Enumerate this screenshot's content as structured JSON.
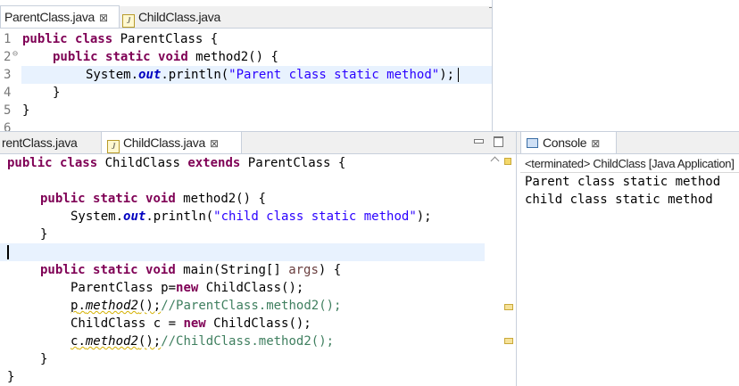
{
  "top_editor": {
    "tabs": [
      {
        "label": "ParentClass.java",
        "close": "⊠"
      },
      {
        "label": "ChildClass.java"
      }
    ],
    "line_numbers": [
      "1",
      "2",
      "3",
      "4",
      "5",
      "6"
    ],
    "fold_marker": "⊖",
    "lines": {
      "l1": {
        "kw1": "public",
        "kw2": "class",
        "rest": " ParentClass {"
      },
      "l2": {
        "kw1": "public",
        "kw2": "static",
        "kw3": "void",
        "rest": " method2() {"
      },
      "l3": {
        "pre": "System.",
        "field": "out",
        "mid": ".println(",
        "str": "\"Parent class static method\"",
        "end": ");"
      },
      "l4": {
        "text": "}"
      },
      "l5": {
        "text": "}"
      }
    }
  },
  "bottom_editor": {
    "tabs": [
      {
        "label": "rentClass.java"
      },
      {
        "label": "ChildClass.java",
        "close": "⊠"
      }
    ],
    "lines": {
      "l1": {
        "kw1": "public",
        "kw2": "class",
        "mid": " ChildClass ",
        "kw3": "extends",
        "rest": " ParentClass {"
      },
      "l2": {
        "kw1": "public",
        "kw2": "static",
        "kw3": "void",
        "rest": " method2() {"
      },
      "l3": {
        "pre": "System.",
        "field": "out",
        "mid": ".println(",
        "str": "\"child class static method\"",
        "end": ");"
      },
      "l4": {
        "text": "}"
      },
      "l5": {
        "kw1": "public",
        "kw2": "static",
        "kw3": "void",
        "mid": " main(String[] ",
        "param": "args",
        "end": ") {"
      },
      "l6": {
        "pre": "ParentClass p=",
        "kw": "new",
        "end": " ChildClass();"
      },
      "l7": {
        "obj": "p",
        "dot": ".",
        "method": "method2",
        "call": "();",
        "comment": "//ParentClass.method2();"
      },
      "l8": {
        "pre": "ChildClass c = ",
        "kw": "new",
        "end": " ChildClass();"
      },
      "l9": {
        "obj": "c",
        "dot": ".",
        "method": "method2",
        "call": "();",
        "comment": "//ChildClass.method2();"
      },
      "l10": {
        "text": "}"
      },
      "l11": {
        "text": "}"
      }
    }
  },
  "console": {
    "title": "Console",
    "close": "⊠",
    "status": "<terminated> ChildClass [Java Application]",
    "output": [
      "Parent class static method",
      "child class static method"
    ]
  },
  "colors": {
    "keyword": "#7f0055",
    "string": "#2a00ff",
    "comment": "#3f7f5f",
    "static_field": "#0000c0",
    "current_line": "#e8f2fe"
  }
}
